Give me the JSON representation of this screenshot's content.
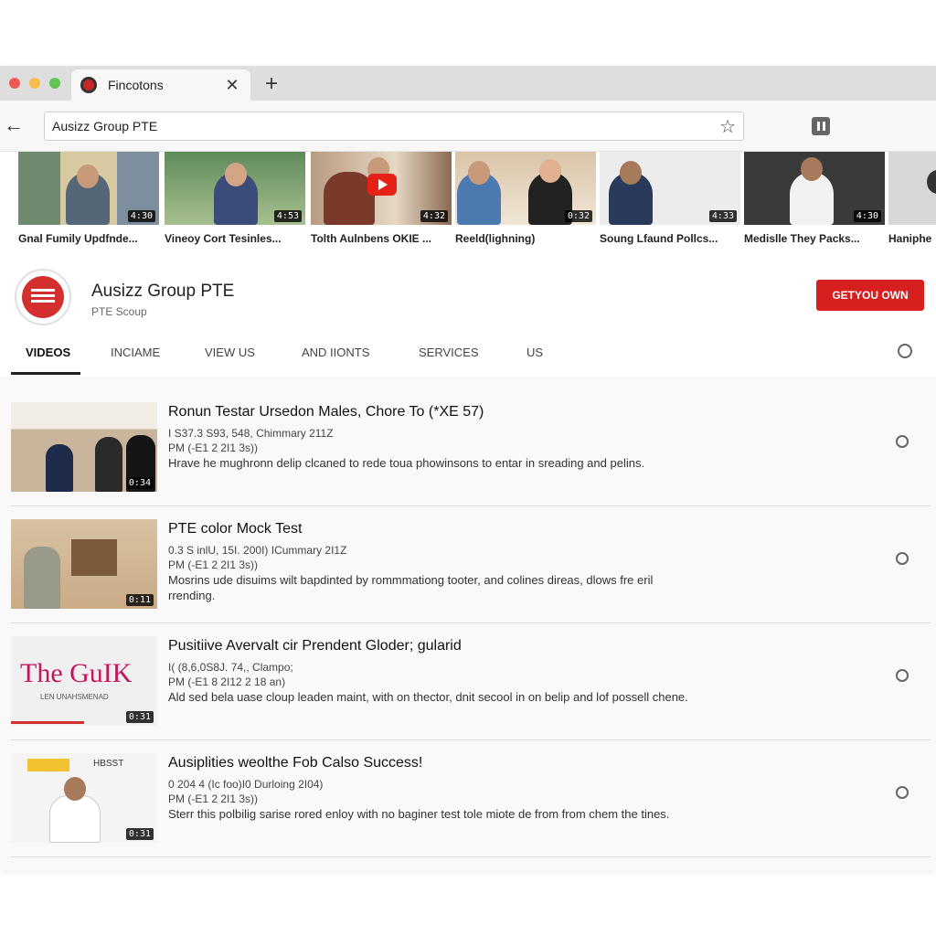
{
  "browser": {
    "tab_title": "Fincotons",
    "address": "Ausizz Group PTE",
    "colors": {
      "close": "#ed5a54",
      "minimize": "#f4be4f",
      "maximize": "#61c454"
    }
  },
  "strip": [
    {
      "title": "Gnal Fumily Updfnde...",
      "duration": "4:30"
    },
    {
      "title": "Vineoy Cort Tesinles...",
      "duration": "4:53"
    },
    {
      "title": "Tolth Aulnbens OKIE ...",
      "duration": "4:32"
    },
    {
      "title": "Reeld(lighning)",
      "duration": "0:32"
    },
    {
      "title": "Soung Lfaund Pollcs...",
      "duration": "4:33"
    },
    {
      "title": "Medislle They Packs...",
      "duration": "4:30"
    },
    {
      "title": "Haniphe",
      "duration": ""
    }
  ],
  "channel": {
    "name": "Ausizz Group PTE",
    "subtitle": "PTE Scoup",
    "cta": "GETYOU OWN",
    "tabs": [
      "VIDEOS",
      "INCIAME",
      "VIEW US",
      "AND IIONTS",
      "SERVICES",
      "US"
    ]
  },
  "videos": [
    {
      "title": "Ronun Testar Ursedon Males, Chore To (*XE 57)",
      "meta1": "I S37.3 S93, 548, Chimmary 211Z",
      "meta2": "PM (-E1 2 2I1 3s))",
      "desc": "Hrave he mughronn delip clcaned to rede toua phowinsons to entar in sreading and pelins.",
      "duration": "0:34"
    },
    {
      "title": "PTE color Mock Test",
      "meta1": "0.3 S inlU, 15I. 200I) ICummary 2I1Z",
      "meta2": "PM (-E1 2 2I1 3s))",
      "desc": "Mosrins ude disuims wilt bapdinted by rommmationg tooter, and colines direas, dlows fre eril rrending.",
      "duration": "0:11"
    },
    {
      "title": "Pusitiive Avervalt cir Prendent Gloder; gularid",
      "meta1": "I( (8,6,0S8J. 74,, Clampo;",
      "meta2": "PM (-E1 8 2I12 2 18 an)",
      "desc": "Ald sed bela uase cloup leaden maint, with on thector, dnit secool in on belip and lof possell chene.",
      "duration": "0:31",
      "thumb_text": "The GuIK",
      "thumb_sub": "LEN UNAHSMENAD"
    },
    {
      "title": "Ausiplities weolthe Fob Calso Success!",
      "meta1": "0 204 4 (Ic foo)I0 Durloing 2I04)",
      "meta2": "PM (-E1 2 2I1 3s))",
      "desc": "Sterr this polbilig sarise rored enloy with no baginer test tole miote de from from chem the tines.",
      "duration": "0:31",
      "thumb_badge": "HBSST"
    }
  ]
}
